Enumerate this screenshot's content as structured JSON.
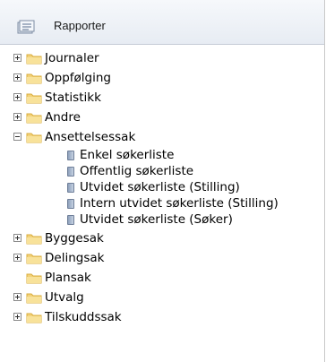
{
  "header": {
    "title": "Rapporter",
    "icon": "report-icon"
  },
  "tree": [
    {
      "label": "Journaler",
      "toggle": "plus"
    },
    {
      "label": "Oppfølging",
      "toggle": "plus"
    },
    {
      "label": "Statistikk",
      "toggle": "plus"
    },
    {
      "label": "Andre",
      "toggle": "plus"
    },
    {
      "label": "Ansettelsessak",
      "toggle": "minus",
      "children": [
        "Enkel søkerliste",
        "Offentlig søkerliste",
        "Utvidet søkerliste (Stilling)",
        "Intern utvidet søkerliste (Stilling)",
        "Utvidet søkerliste (Søker)"
      ]
    },
    {
      "label": "Byggesak",
      "toggle": "plus"
    },
    {
      "label": "Delingsak",
      "toggle": "plus"
    },
    {
      "label": "Plansak",
      "toggle": "none"
    },
    {
      "label": "Utvalg",
      "toggle": "plus"
    },
    {
      "label": "Tilskuddssak",
      "toggle": "plus"
    }
  ],
  "colors": {
    "folder": "#f3d27a",
    "folder_dark": "#d9ad3c",
    "header_bg": "#eef2f7"
  }
}
